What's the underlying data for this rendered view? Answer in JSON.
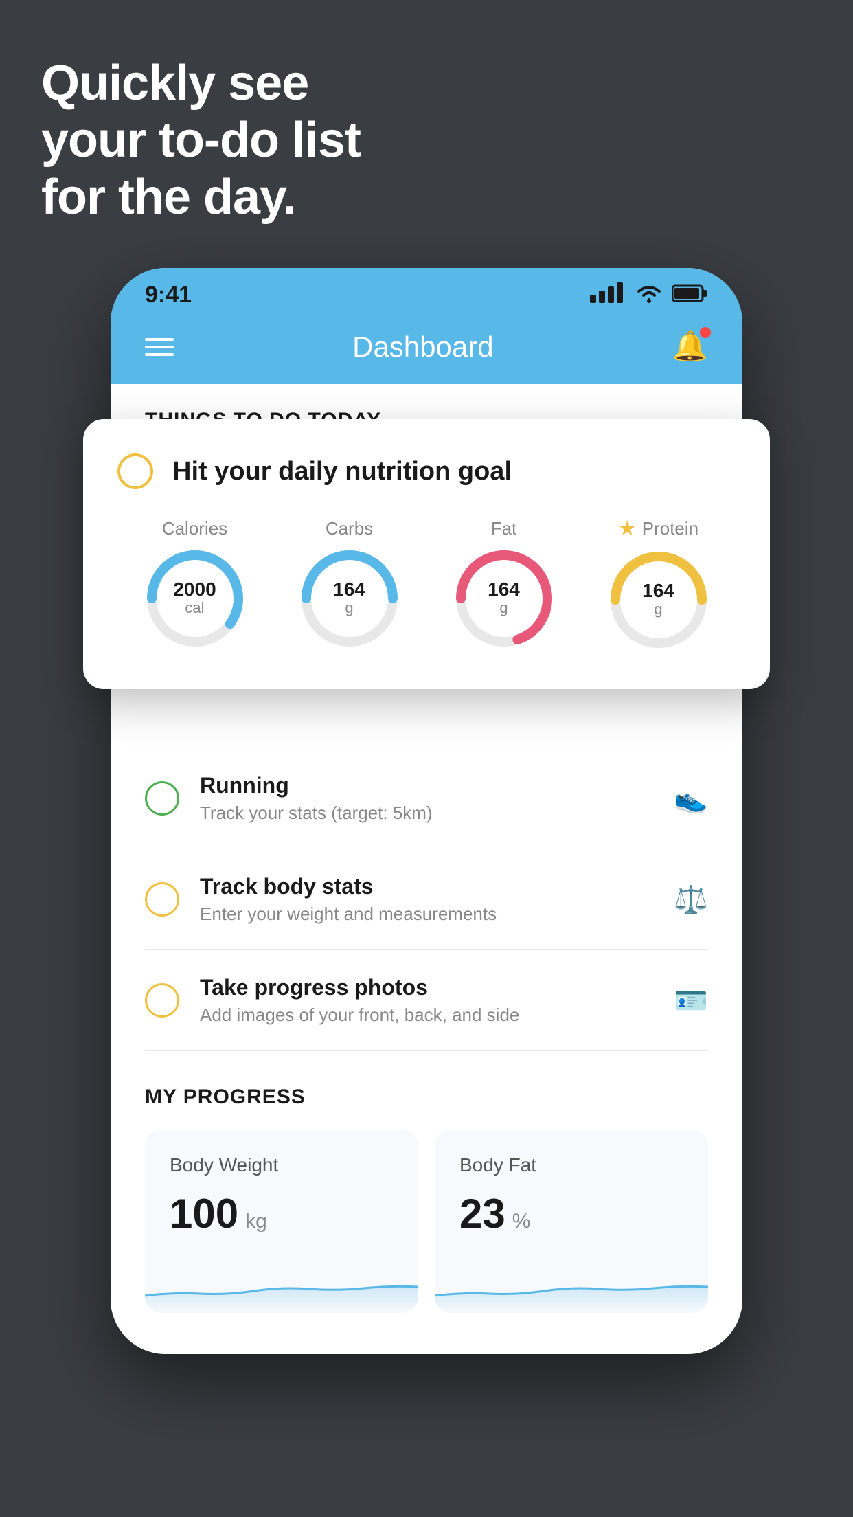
{
  "hero": {
    "line1": "Quickly see",
    "line2": "your to-do list",
    "line3": "for the day."
  },
  "status_bar": {
    "time": "9:41",
    "signal": "▌▌▌▌",
    "wifi": "wifi",
    "battery": "battery"
  },
  "header": {
    "title": "Dashboard"
  },
  "things_header": "THINGS TO DO TODAY",
  "floating_card": {
    "title": "Hit your daily nutrition goal",
    "items": [
      {
        "label": "Calories",
        "value": "2000",
        "unit": "cal",
        "color": "#58b8e8",
        "pct": 0.6
      },
      {
        "label": "Carbs",
        "value": "164",
        "unit": "g",
        "color": "#58b8e8",
        "pct": 0.5
      },
      {
        "label": "Fat",
        "value": "164",
        "unit": "g",
        "color": "#e85878",
        "pct": 0.7
      },
      {
        "label": "Protein",
        "value": "164",
        "unit": "g",
        "color": "#f0c040",
        "pct": 0.5,
        "star": true
      }
    ]
  },
  "todo_items": [
    {
      "title": "Running",
      "subtitle": "Track your stats (target: 5km)",
      "circle_color": "green",
      "icon": "👟"
    },
    {
      "title": "Track body stats",
      "subtitle": "Enter your weight and measurements",
      "circle_color": "yellow",
      "icon": "⚖️"
    },
    {
      "title": "Take progress photos",
      "subtitle": "Add images of your front, back, and side",
      "circle_color": "yellow",
      "icon": "🪪"
    }
  ],
  "progress": {
    "header": "MY PROGRESS",
    "cards": [
      {
        "title": "Body Weight",
        "value": "100",
        "unit": "kg"
      },
      {
        "title": "Body Fat",
        "value": "23",
        "unit": "%"
      }
    ]
  }
}
